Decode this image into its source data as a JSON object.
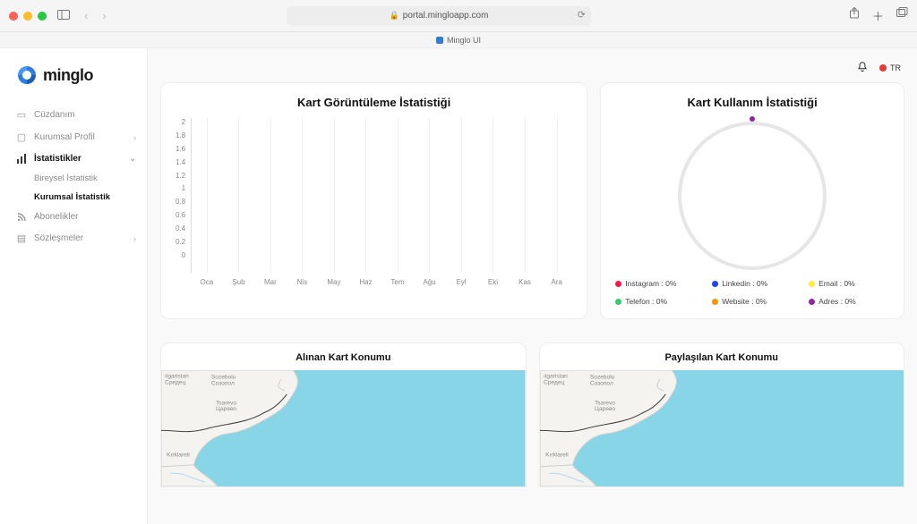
{
  "browser": {
    "url": "portal.mingloapp.com",
    "tab_title": "Minglo UI"
  },
  "brand": {
    "name": "minglo"
  },
  "language": {
    "code": "TR"
  },
  "nav": {
    "items": [
      {
        "id": "wallet",
        "label": "Cüzdanım",
        "icon": "card-icon",
        "expandable": false
      },
      {
        "id": "profile",
        "label": "Kurumsal Profil",
        "icon": "building-icon",
        "expandable": true
      },
      {
        "id": "stats",
        "label": "İstatistikler",
        "icon": "chart-icon",
        "expandable": true,
        "active": true
      },
      {
        "id": "subs",
        "label": "Abonelikler",
        "icon": "rss-icon",
        "expandable": false
      },
      {
        "id": "contracts",
        "label": "Sözleşmeler",
        "icon": "doc-icon",
        "expandable": true
      }
    ],
    "stats_children": [
      {
        "id": "individual",
        "label": "Bireysel İstatistik",
        "active": false
      },
      {
        "id": "corporate",
        "label": "Kurumsal İstatistik",
        "active": true
      }
    ]
  },
  "cards": {
    "views_title": "Kart Görüntüleme İstatistiği",
    "usage_title": "Kart Kullanım İstatistiği",
    "map_received_title": "Alınan Kart Konumu",
    "map_shared_title": "Paylaşılan Kart Konumu"
  },
  "usage_legend": [
    {
      "label": "Instagram : 0%",
      "color": "#ff1744"
    },
    {
      "label": "Linkedin : 0%",
      "color": "#1e40ff"
    },
    {
      "label": "Email : 0%",
      "color": "#ffeb3b"
    },
    {
      "label": "Telefon : 0%",
      "color": "#2ecc71"
    },
    {
      "label": "Website : 0%",
      "color": "#ff9100"
    },
    {
      "label": "Adres : 0%",
      "color": "#8e24aa"
    }
  ],
  "map_labels": {
    "l1": "ılgaristan\nСредец",
    "l2": "Sozebolu\nСозопол",
    "l3": "Tsarevo\nЦарево",
    "l4": "Kırklareli"
  },
  "chart_data": {
    "type": "bar",
    "title": "Kart Görüntüleme İstatistiği",
    "categories": [
      "Oca",
      "Şub",
      "Mar",
      "Nis",
      "May",
      "Haz",
      "Tem",
      "Ağu",
      "Eyl",
      "Eki",
      "Kas",
      "Ara"
    ],
    "values": [
      0,
      0,
      0,
      0,
      0,
      0,
      0,
      0,
      0,
      0,
      0,
      0
    ],
    "y_ticks": [
      2,
      1.8,
      1.6,
      1.4,
      1.2,
      1,
      0.8,
      0.6,
      0.4,
      0.2,
      0
    ],
    "ylim": [
      0,
      2
    ],
    "xlabel": "",
    "ylabel": ""
  }
}
